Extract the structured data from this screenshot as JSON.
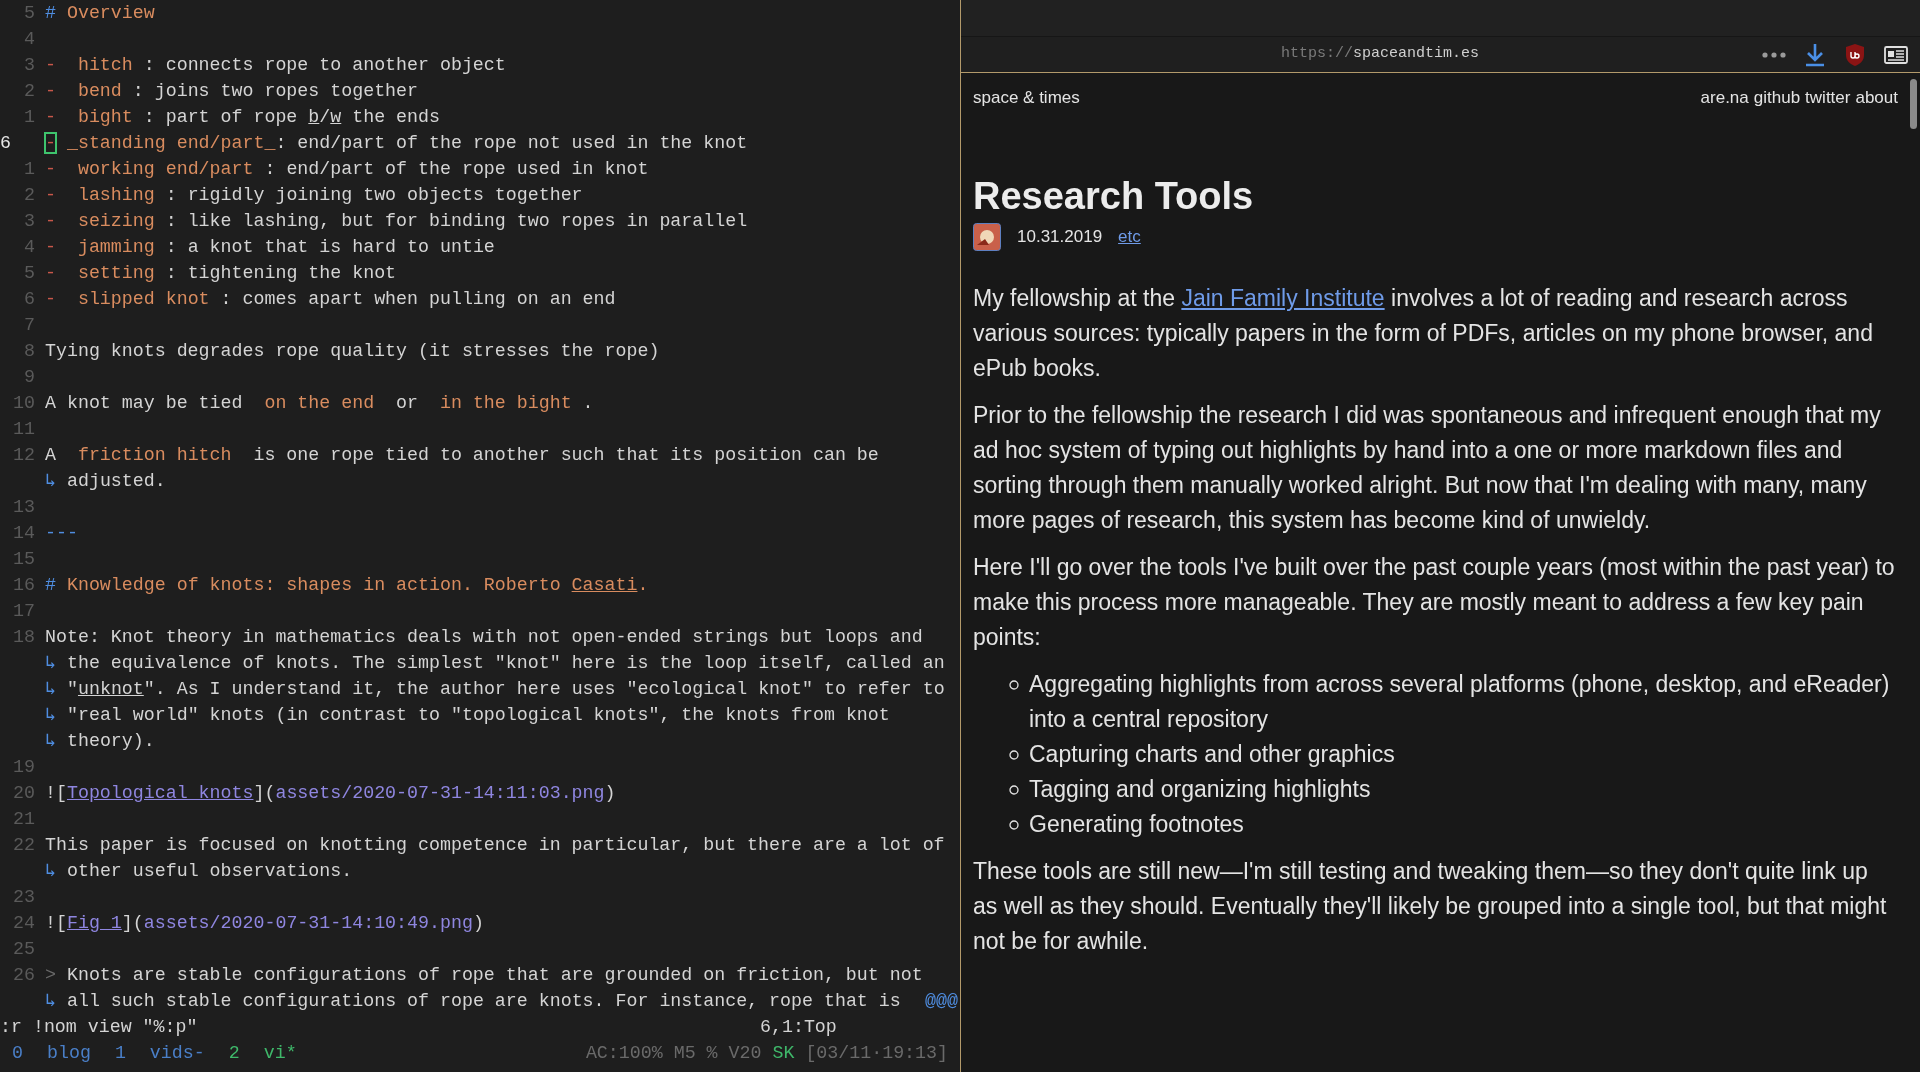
{
  "editor": {
    "lines": [
      {
        "number": "5",
        "segments": [
          {
            "text": "# ",
            "kind": "mark"
          },
          {
            "text": "Overview",
            "kind": "heading"
          }
        ]
      },
      {
        "number": "4"
      },
      {
        "number": "3",
        "segments": [
          {
            "text": "-",
            "kind": "bullet"
          },
          {
            "text": "  hitch ",
            "kind": "term"
          },
          {
            "text": ": connects rope to another object",
            "kind": "plain"
          }
        ]
      },
      {
        "number": "2",
        "segments": [
          {
            "text": "-",
            "kind": "bullet"
          },
          {
            "text": "  bend ",
            "kind": "term"
          },
          {
            "text": ": joins two ropes together",
            "kind": "plain"
          }
        ]
      },
      {
        "number": "1",
        "segments": [
          {
            "text": "-",
            "kind": "bullet"
          },
          {
            "text": "  bight ",
            "kind": "term"
          },
          {
            "text": ": part of rope ",
            "kind": "plain"
          },
          {
            "text": "b",
            "kind": "underline"
          },
          {
            "text": "/",
            "kind": "plain"
          },
          {
            "text": "w",
            "kind": "underline"
          },
          {
            "text": " the ends",
            "kind": "plain"
          }
        ]
      },
      {
        "number": "6",
        "current": true,
        "segments": [
          {
            "text": "-",
            "kind": "cursor"
          },
          {
            "text": " _standing end/part_",
            "kind": "term"
          },
          {
            "text": ": end/part of the rope not used in the knot",
            "kind": "plain"
          }
        ]
      },
      {
        "number": "1",
        "segments": [
          {
            "text": "-",
            "kind": "bullet"
          },
          {
            "text": "  working end/part ",
            "kind": "term"
          },
          {
            "text": ": end/part of the rope used in knot",
            "kind": "plain"
          }
        ]
      },
      {
        "number": "2",
        "segments": [
          {
            "text": "-",
            "kind": "bullet"
          },
          {
            "text": "  lashing ",
            "kind": "term"
          },
          {
            "text": ": rigidly joining two objects together",
            "kind": "plain"
          }
        ]
      },
      {
        "number": "3",
        "segments": [
          {
            "text": "-",
            "kind": "bullet"
          },
          {
            "text": "  seizing ",
            "kind": "term"
          },
          {
            "text": ": like lashing, but for binding two ropes in parallel",
            "kind": "plain"
          }
        ]
      },
      {
        "number": "4",
        "segments": [
          {
            "text": "-",
            "kind": "bullet"
          },
          {
            "text": "  jamming ",
            "kind": "term"
          },
          {
            "text": ": a knot that is hard to untie",
            "kind": "plain"
          }
        ]
      },
      {
        "number": "5",
        "segments": [
          {
            "text": "-",
            "kind": "bullet"
          },
          {
            "text": "  setting ",
            "kind": "term"
          },
          {
            "text": ": tightening the knot",
            "kind": "plain"
          }
        ]
      },
      {
        "number": "6",
        "segments": [
          {
            "text": "-",
            "kind": "bullet"
          },
          {
            "text": "  slipped knot ",
            "kind": "term"
          },
          {
            "text": ": comes apart when pulling on an end",
            "kind": "plain"
          }
        ]
      },
      {
        "number": "7"
      },
      {
        "number": "8",
        "segments": [
          {
            "text": "Tying knots degrades rope quality (it stresses the rope)",
            "kind": "plain"
          }
        ]
      },
      {
        "number": "9"
      },
      {
        "number": "10",
        "segments": [
          {
            "text": "A knot may be tied  ",
            "kind": "plain"
          },
          {
            "text": "on the end",
            "kind": "term"
          },
          {
            "text": "  or  ",
            "kind": "plain"
          },
          {
            "text": "in the bight",
            "kind": "term"
          },
          {
            "text": " .",
            "kind": "plain"
          }
        ]
      },
      {
        "number": "11"
      },
      {
        "number": "12",
        "segments": [
          {
            "text": "A  ",
            "kind": "plain"
          },
          {
            "text": "friction hitch",
            "kind": "term"
          },
          {
            "text": "  is one rope tied to another such that its position can be",
            "kind": "plain"
          }
        ]
      },
      {
        "segments": [
          {
            "text": "↳ ",
            "kind": "wrap"
          },
          {
            "text": "adjusted.",
            "kind": "plain"
          }
        ]
      },
      {
        "number": "13"
      },
      {
        "number": "14",
        "segments": [
          {
            "text": "---",
            "kind": "mark"
          }
        ]
      },
      {
        "number": "15"
      },
      {
        "number": "16",
        "segments": [
          {
            "text": "# ",
            "kind": "mark"
          },
          {
            "text": "Knowledge of knots: shapes in action. Roberto ",
            "kind": "heading"
          },
          {
            "text": "Casati",
            "kind": "heading_link"
          },
          {
            "text": ".",
            "kind": "heading"
          }
        ]
      },
      {
        "number": "17"
      },
      {
        "number": "18",
        "segments": [
          {
            "text": "Note: Knot theory in mathematics deals with not open-ended strings but loops and",
            "kind": "plain"
          }
        ]
      },
      {
        "segments": [
          {
            "text": "↳ ",
            "kind": "wrap"
          },
          {
            "text": "the equivalence of knots. The simplest \"knot\" here is the loop itself, called an",
            "kind": "plain"
          }
        ]
      },
      {
        "segments": [
          {
            "text": "↳ ",
            "kind": "wrap"
          },
          {
            "text": "\"",
            "kind": "plain"
          },
          {
            "text": "unknot",
            "kind": "underline"
          },
          {
            "text": "\". As I understand it, the author here uses \"ecological knot\" to refer to",
            "kind": "plain"
          }
        ]
      },
      {
        "segments": [
          {
            "text": "↳ ",
            "kind": "wrap"
          },
          {
            "text": "\"real world\" knots (in contrast to \"topological knots\", the knots from knot",
            "kind": "plain"
          }
        ]
      },
      {
        "segments": [
          {
            "text": "↳ ",
            "kind": "wrap"
          },
          {
            "text": "theory).",
            "kind": "plain"
          }
        ]
      },
      {
        "number": "19"
      },
      {
        "number": "20",
        "segments": [
          {
            "text": "![",
            "kind": "plain"
          },
          {
            "text": "Topological knots",
            "kind": "link"
          },
          {
            "text": "](",
            "kind": "plain"
          },
          {
            "text": "assets/2020-07-31-14:11:03.png",
            "kind": "url"
          },
          {
            "text": ")",
            "kind": "plain"
          }
        ]
      },
      {
        "number": "21"
      },
      {
        "number": "22",
        "segments": [
          {
            "text": "This paper is focused on knotting competence in particular, but there are a lot of",
            "kind": "plain"
          }
        ]
      },
      {
        "segments": [
          {
            "text": "↳ ",
            "kind": "wrap"
          },
          {
            "text": "other useful observations.",
            "kind": "plain"
          }
        ]
      },
      {
        "number": "23"
      },
      {
        "number": "24",
        "segments": [
          {
            "text": "![",
            "kind": "plain"
          },
          {
            "text": "Fig 1",
            "kind": "link"
          },
          {
            "text": "](",
            "kind": "plain"
          },
          {
            "text": "assets/2020-07-31-14:10:49.png",
            "kind": "url"
          },
          {
            "text": ")",
            "kind": "plain"
          }
        ]
      },
      {
        "number": "25"
      },
      {
        "number": "26",
        "segments": [
          {
            "text": "> ",
            "kind": "dim"
          },
          {
            "text": "Knots are stable configurations of rope that are grounded on friction, but not",
            "kind": "plain"
          }
        ]
      },
      {
        "segments": [
          {
            "text": "↳ ",
            "kind": "wrap"
          },
          {
            "text": "all such stable configurations of rope are knots. For instance, rope that is",
            "kind": "plain"
          }
        ],
        "overflow": "@@@"
      }
    ],
    "command": ":r !nom view \"%:p\"",
    "position": "6,1:Top"
  },
  "tmux": {
    "windows": [
      {
        "index": "0",
        "name": "blog",
        "selected": false
      },
      {
        "index": "1",
        "name": "vids-",
        "selected": false
      },
      {
        "index": "2",
        "name": "vi*",
        "selected": true
      }
    ],
    "status": "AC:100% M5 % V20",
    "keyboard": "SK",
    "clock": "[03/11·19:13]"
  },
  "browser": {
    "url_scheme": "https://",
    "url_host": "spaceandtim.es",
    "site_title": "space & times",
    "nav": [
      "are.na",
      "github",
      "twitter",
      "about"
    ],
    "title": "Research Tools",
    "date": "10.31.2019",
    "tag": "etc",
    "paragraphs": [
      [
        {
          "text": "My fellowship at the ",
          "kind": "plain"
        },
        {
          "text": "Jain Family Institute",
          "kind": "link"
        },
        {
          "text": " involves a lot of reading and research across various sources: typically papers in the form of PDFs, articles on my phone browser, and ePub books.",
          "kind": "plain"
        }
      ],
      [
        {
          "text": "Prior to the fellowship the research I did was spontaneous and infrequent enough that my ad hoc system of typing out highlights by hand into a one or more markdown files and sorting through them manually worked alright. But now that I'm dealing with many, many more pages of research, this system has become kind of unwieldy.",
          "kind": "plain"
        }
      ],
      [
        {
          "text": "Here I'll go over the tools I've built over the past couple years (most within the past year) to make this process more manageable. They are mostly meant to address a few key pain points:",
          "kind": "plain"
        }
      ]
    ],
    "list": [
      "Aggregating highlights from across several platforms (phone, desktop, and eReader) into a central repository",
      "Capturing charts and other graphics",
      "Tagging and organizing highlights",
      "Generating footnotes"
    ],
    "closing": [
      [
        {
          "text": "These tools are still new—I'm still testing and tweaking them—so they don't quite link up as well as they should. Eventually they'll likely be grouped into a single tool, but that might not be for awhile.",
          "kind": "plain"
        }
      ]
    ]
  }
}
